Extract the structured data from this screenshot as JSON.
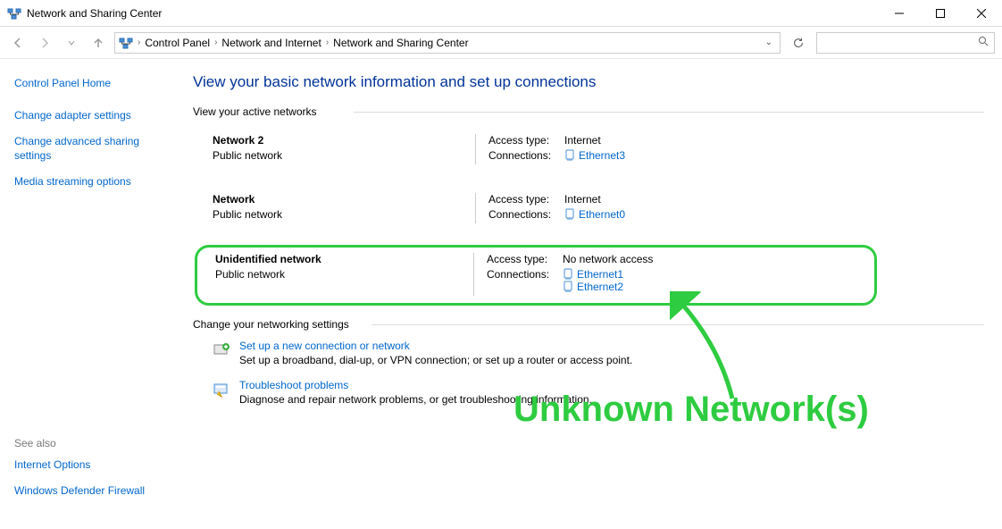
{
  "window": {
    "title": "Network and Sharing Center"
  },
  "breadcrumb": {
    "items": [
      "Control Panel",
      "Network and Internet",
      "Network and Sharing Center"
    ]
  },
  "search": {
    "placeholder": ""
  },
  "sidebar": {
    "home": "Control Panel Home",
    "links": [
      "Change adapter settings",
      "Change advanced sharing settings",
      "Media streaming options"
    ],
    "see_also_label": "See also",
    "see_also": [
      "Internet Options",
      "Windows Defender Firewall"
    ]
  },
  "main": {
    "heading": "View your basic network information and set up connections",
    "active_section": "View your active networks",
    "networks": [
      {
        "name": "Network 2",
        "type": "Public network",
        "access_label": "Access type:",
        "access_value": "Internet",
        "conn_label": "Connections:",
        "connections": [
          "Ethernet3"
        ]
      },
      {
        "name": "Network",
        "type": "Public network",
        "access_label": "Access type:",
        "access_value": "Internet",
        "conn_label": "Connections:",
        "connections": [
          "Ethernet0"
        ]
      },
      {
        "name": "Unidentified network",
        "type": "Public network",
        "access_label": "Access type:",
        "access_value": "No network access",
        "conn_label": "Connections:",
        "connections": [
          "Ethernet1",
          "Ethernet2"
        ]
      }
    ],
    "change_section": "Change your networking settings",
    "settings": [
      {
        "title": "Set up a new connection or network",
        "desc": "Set up a broadband, dial-up, or VPN connection; or set up a router or access point."
      },
      {
        "title": "Troubleshoot problems",
        "desc": "Diagnose and repair network problems, or get troubleshooting information."
      }
    ]
  },
  "annotation": {
    "text": "Unknown Network(s)"
  }
}
